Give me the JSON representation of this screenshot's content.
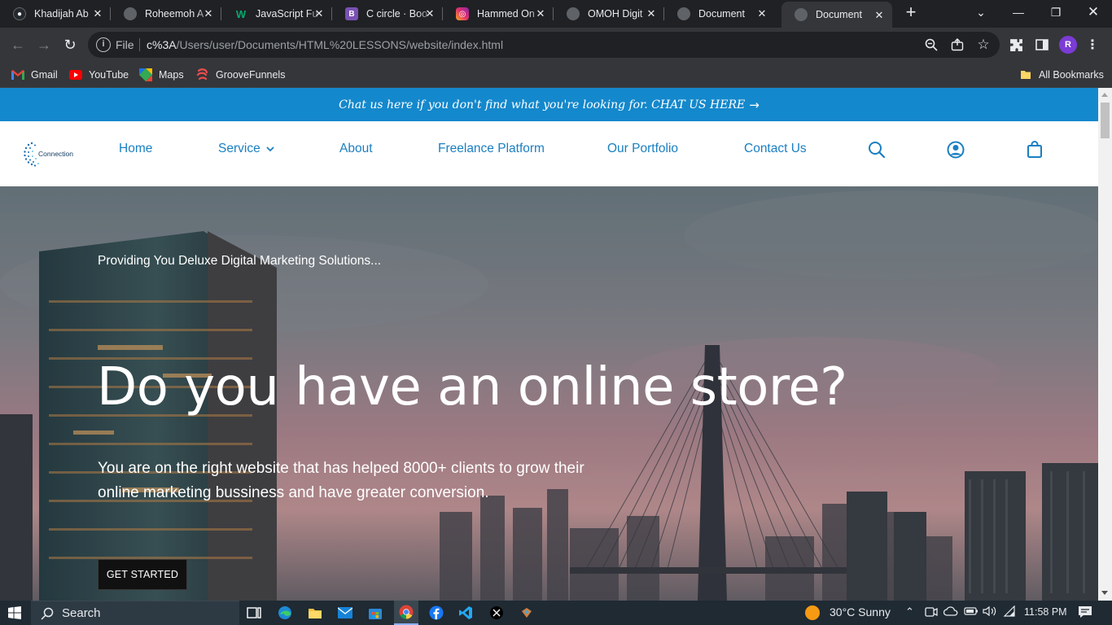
{
  "browser": {
    "tabs": [
      {
        "title": "Khadijah Ab",
        "icon": "github-icon",
        "color": "#24292f"
      },
      {
        "title": "Roheemoh A",
        "icon": "globe-icon",
        "color": "#5f6368"
      },
      {
        "title": "JavaScript Fu",
        "icon": "w3schools-icon",
        "color": "#04aa6d"
      },
      {
        "title": "C circle · Boo",
        "icon": "bootstrap-icon",
        "color": "#7952b3"
      },
      {
        "title": "Hammed On",
        "icon": "instagram-icon",
        "color": "#e1306c"
      },
      {
        "title": "OMOH Digit",
        "icon": "globe-icon",
        "color": "#5f6368"
      },
      {
        "title": "Document",
        "icon": "globe-icon",
        "color": "#5f6368"
      },
      {
        "title": "Document",
        "icon": "globe-icon",
        "color": "#5f6368",
        "active": true
      }
    ],
    "new_tab": "+",
    "address": {
      "scheme_label": "File",
      "url_highlight": "c%3A",
      "url_rest": "/Users/user/Documents/HTML%20LESSONS/website/index.html"
    },
    "profile_initial": "R",
    "bookmarks": [
      {
        "label": "Gmail",
        "icon": "gmail-icon"
      },
      {
        "label": "YouTube",
        "icon": "youtube-icon"
      },
      {
        "label": "Maps",
        "icon": "maps-icon"
      },
      {
        "label": "GrooveFunnels",
        "icon": "groovefunnels-icon"
      }
    ],
    "all_bookmarks": "All Bookmarks"
  },
  "site": {
    "promo": "Chat us here if you don't find what you're looking for. CHAT US HERE",
    "logo_text": "Connection",
    "nav": {
      "home": "Home",
      "service": "Service",
      "about": "About",
      "freelance": "Freelance Platform",
      "portfolio": "Our Portfolio",
      "contact": "Contact Us"
    },
    "hero": {
      "tagline": "Providing You Deluxe Digital Marketing Solutions...",
      "heading": "Do you have an online store?",
      "subtext": "You are on the right website that has helped 8000+ clients to grow their online marketing bussiness and have greater conversion.",
      "cta": "GET STARTED"
    },
    "accent_color": "#1488cc"
  },
  "taskbar": {
    "search_placeholder": "Search",
    "weather": "30°C  Sunny",
    "time": "11:58 PM"
  }
}
